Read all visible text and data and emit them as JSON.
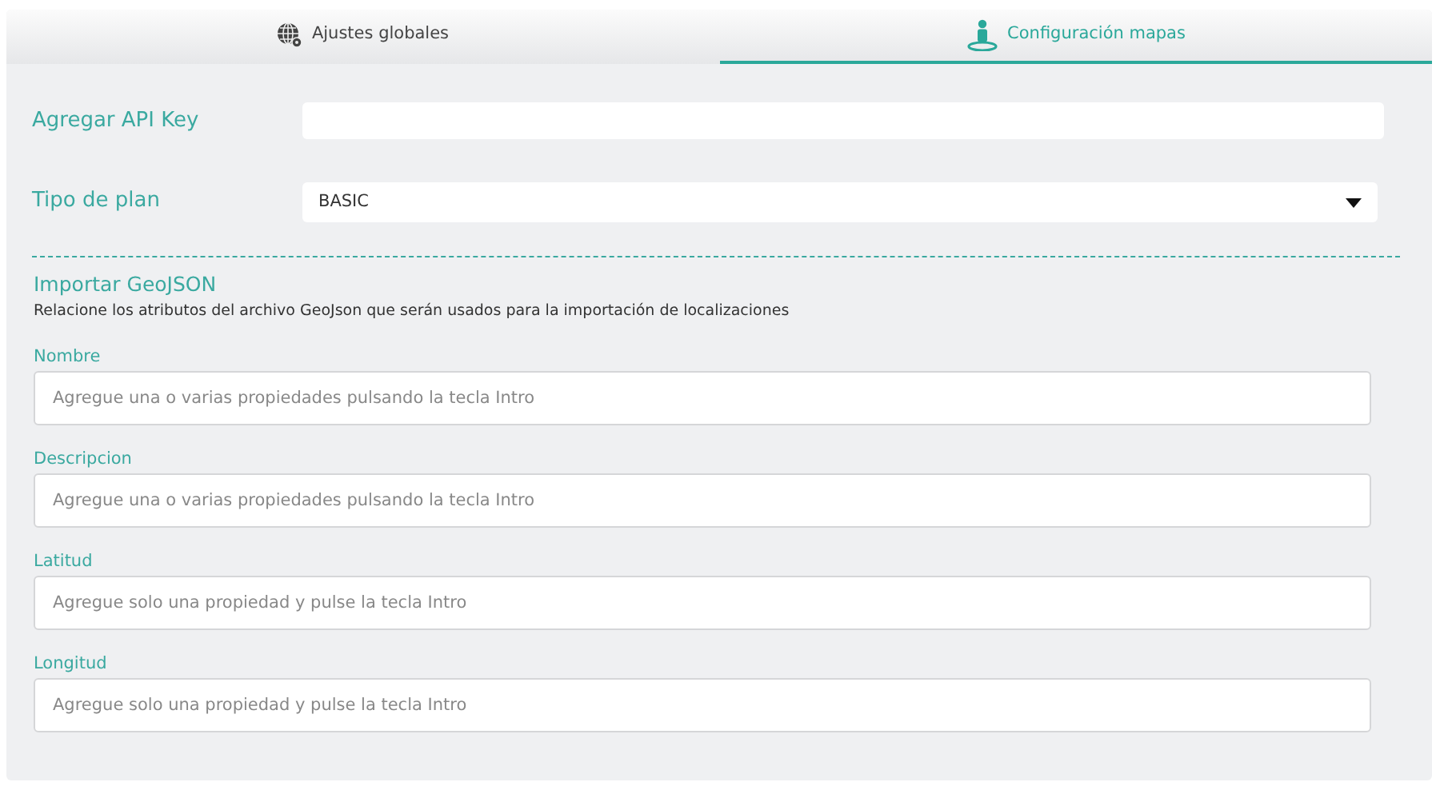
{
  "tabs": [
    {
      "label": "Ajustes globales",
      "selected": false
    },
    {
      "label": "Configuración mapas",
      "selected": true
    }
  ],
  "api_key": {
    "label": "Agregar API Key"
  },
  "plan": {
    "label": "Tipo de plan",
    "value": "BASIC"
  },
  "geojson": {
    "title": "Importar GeoJSON",
    "description": "Relacione los atributos del archivo GeoJson que serán usados para la importación de localizaciones",
    "fields": [
      {
        "label": "Nombre",
        "placeholder": "Agregue una o varias propiedades pulsando la tecla Intro"
      },
      {
        "label": "Descripcion",
        "placeholder": "Agregue una o varias propiedades pulsando la tecla Intro"
      },
      {
        "label": "Latitud",
        "placeholder": "Agregue solo una propiedad y pulse la tecla Intro"
      },
      {
        "label": "Longitud",
        "placeholder": "Agregue solo una propiedad y pulse la tecla Intro"
      }
    ]
  }
}
